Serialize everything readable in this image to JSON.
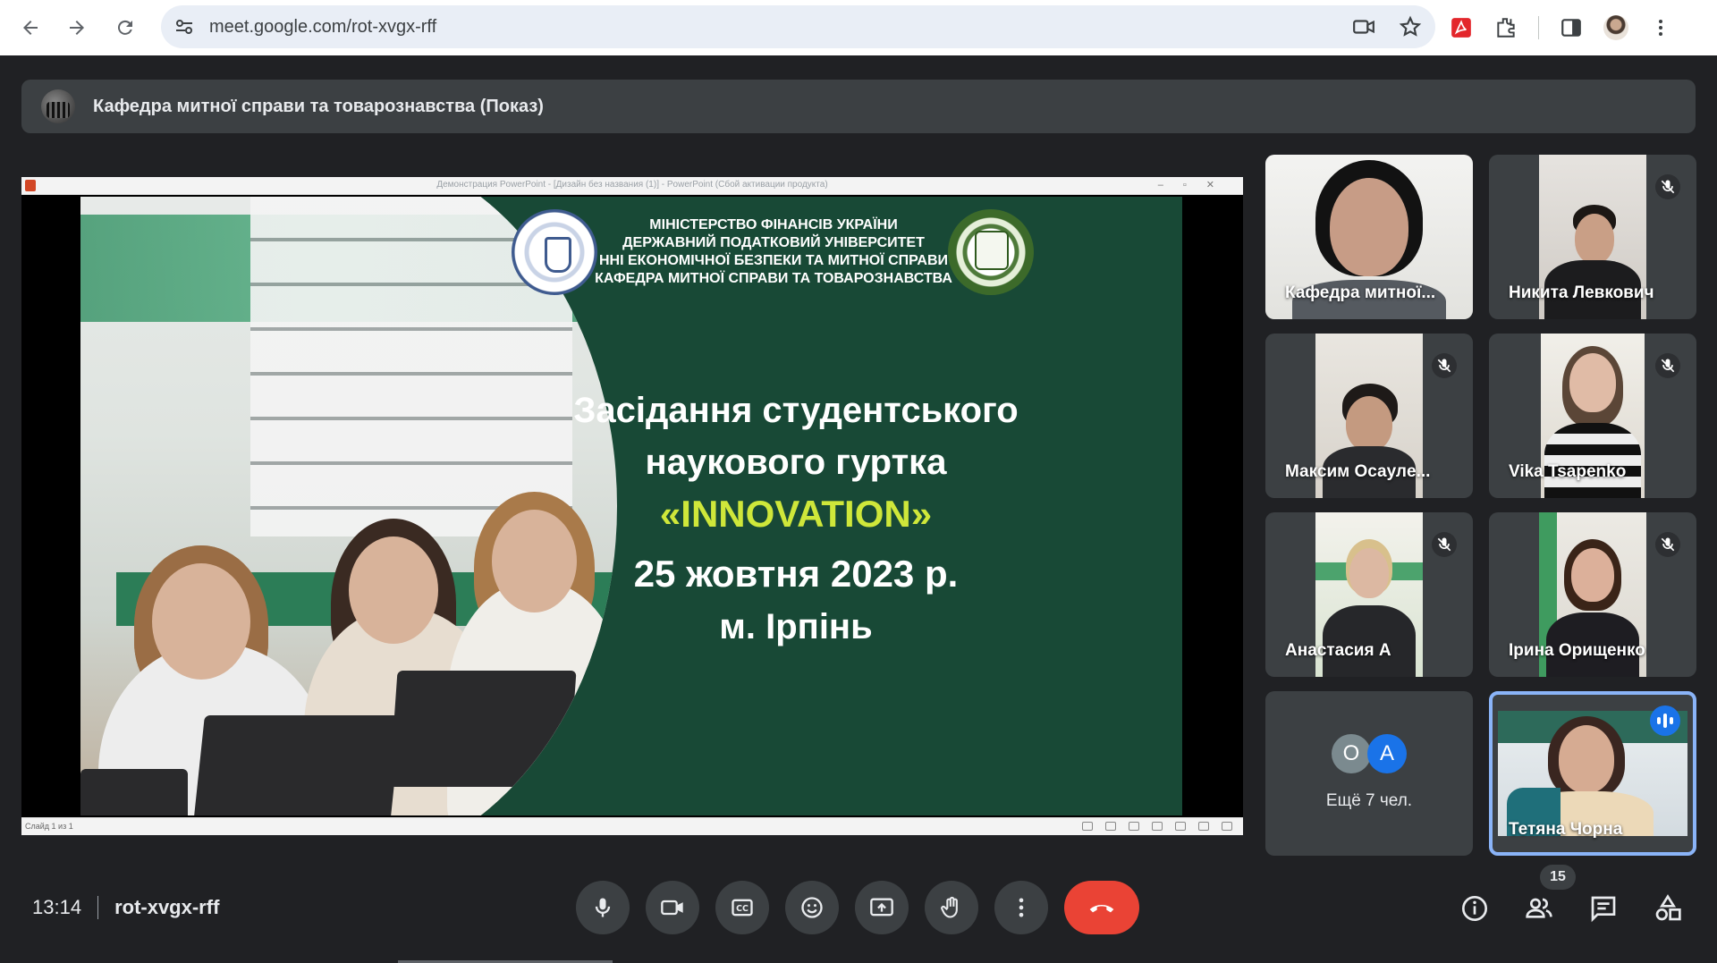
{
  "browser": {
    "url": "meet.google.com/rot-xvgx-rff",
    "icons": [
      "back-arrow-icon",
      "forward-arrow-icon",
      "reload-icon",
      "site-settings-icon",
      "camera-icon",
      "star-icon",
      "pdf-extension-icon",
      "extensions-icon",
      "side-panel-icon",
      "profile-avatar",
      "more-vert-icon"
    ]
  },
  "meeting": {
    "presenter_title": "Кафедра митної справи та товарознавства (Показ)",
    "time": "13:14",
    "code": "rot-xvgx-rff",
    "participant_count": "15"
  },
  "presentation": {
    "window_title": "Демонстрация PowerPoint - [Дизайн без названия (1)] - PowerPoint (Сбой активации продукта)",
    "status_left": "Слайд 1 из 1",
    "ministry_lines": [
      "МІНІСТЕРСТВО ФІНАНСІВ УКРАЇНИ",
      "ДЕРЖАВНИЙ ПОДАТКОВИЙ УНІВЕРСИТЕТ",
      "ННІ ЕКОНОМІЧНОЇ БЕЗПЕКИ ТА МИТНОЇ СПРАВИ",
      "КАФЕДРА МИТНОЇ СПРАВИ ТА ТОВАРОЗНАВСТВА"
    ],
    "headline_1": "Засідання студентського",
    "headline_2": "наукового гуртка",
    "headline_3": "«INNOVATION»",
    "date_line": "25 жовтня 2023 р.",
    "city_line": "м. Ірпінь",
    "accent_color": "#cfe73a",
    "slide_bg": "#184936"
  },
  "participants": [
    {
      "name": "Кафедра митної...",
      "muted": false
    },
    {
      "name": "Никита Левкович",
      "muted": true
    },
    {
      "name": "Максим Осаулe...",
      "muted": true
    },
    {
      "name": "Vika Tsapenko",
      "muted": true
    },
    {
      "name": "Анастасия А",
      "muted": true
    },
    {
      "name": "Ірина Орищенко",
      "muted": true
    },
    {
      "name": "Тетяна Чорна",
      "muted": false,
      "speaking": true
    }
  ],
  "others": {
    "initials": [
      "О",
      "А"
    ],
    "label": "Ещё 7 чел.",
    "colors": [
      "#7b8a8f",
      "#1a73e8"
    ]
  },
  "controls": {
    "buttons": [
      "microphone-icon",
      "camera-icon",
      "captions-icon",
      "emoji-icon",
      "present-screen-icon",
      "raise-hand-icon",
      "more-options-icon",
      "end-call-icon"
    ],
    "right": [
      "meeting-info-icon",
      "people-icon",
      "chat-icon",
      "activities-icon"
    ]
  },
  "colors": {
    "meet_bg": "#202124",
    "tile_bg": "#3c4043",
    "end_call": "#ea4335",
    "speaking_border": "#8ab4f8"
  }
}
